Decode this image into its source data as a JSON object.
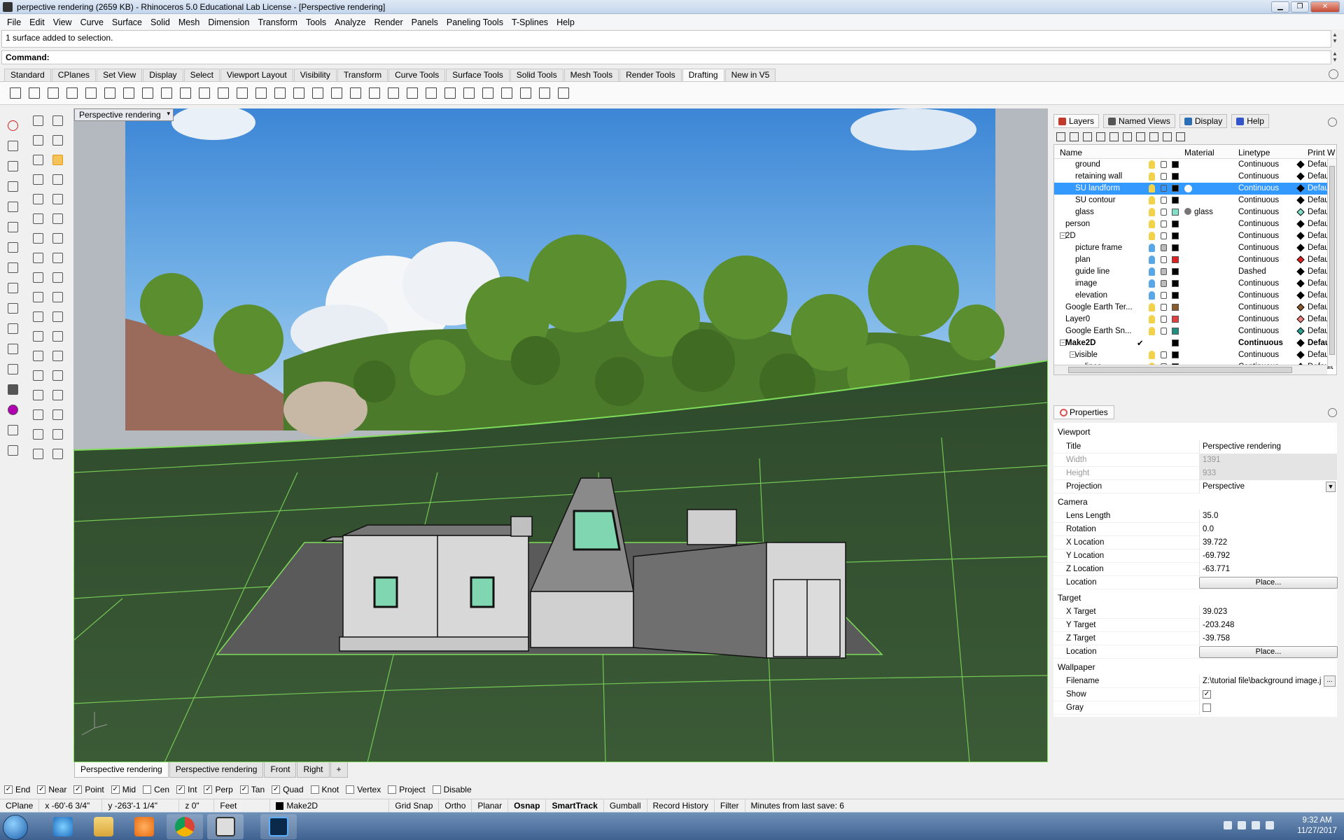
{
  "window": {
    "title": "perpective rendering (2659 KB) - Rhinoceros 5.0 Educational Lab License - [Perspective rendering]"
  },
  "menu": [
    "File",
    "Edit",
    "View",
    "Curve",
    "Surface",
    "Solid",
    "Mesh",
    "Dimension",
    "Transform",
    "Tools",
    "Analyze",
    "Render",
    "Panels",
    "Paneling Tools",
    "T-Splines",
    "Help"
  ],
  "command": {
    "history": "1 surface added to selection.",
    "prompt": "Command:"
  },
  "toolbar_tabs": [
    "Standard",
    "CPlanes",
    "Set View",
    "Display",
    "Select",
    "Viewport Layout",
    "Visibility",
    "Transform",
    "Curve Tools",
    "Surface Tools",
    "Solid Tools",
    "Mesh Tools",
    "Render Tools",
    "Drafting",
    "New in V5"
  ],
  "active_toolbar_tab": "Drafting",
  "viewport": {
    "label": "Perspective rendering",
    "bottom_tabs": [
      "Perspective rendering",
      "Perspective rendering",
      "Front",
      "Right"
    ],
    "add_tab": "+"
  },
  "panels": {
    "tabs": [
      "Layers",
      "Named Views",
      "Display",
      "Help"
    ],
    "layers_columns": {
      "name": "Name",
      "material": "Material",
      "linetype": "Linetype",
      "print": "Print W"
    },
    "layers": [
      {
        "name": "ground",
        "indent": 2,
        "color": "#000000",
        "linetype": "Continuous",
        "print": "Default",
        "bulb": "on",
        "lock": "open"
      },
      {
        "name": "retaining wall",
        "indent": 2,
        "color": "#000000",
        "linetype": "Continuous",
        "print": "Default",
        "bulb": "on",
        "lock": "open"
      },
      {
        "name": "SU landform",
        "indent": 2,
        "color": "#000000",
        "linetype": "Continuous",
        "print": "Default",
        "bulb": "on",
        "lock": "open",
        "selected": true
      },
      {
        "name": "SU contour",
        "indent": 2,
        "color": "#000000",
        "linetype": "Continuous",
        "print": "Default",
        "bulb": "on",
        "lock": "open"
      },
      {
        "name": "glass",
        "indent": 2,
        "color": "#7fe0c8",
        "linetype": "Continuous",
        "print": "Default",
        "bulb": "on",
        "lock": "open",
        "material": "glass",
        "print_color": "#7fe0c8"
      },
      {
        "name": "person",
        "indent": 1,
        "color": "#000000",
        "linetype": "Continuous",
        "print": "Default",
        "bulb": "on",
        "lock": "open"
      },
      {
        "name": "2D",
        "indent": 1,
        "color": "#000000",
        "linetype": "Continuous",
        "print": "Default",
        "bulb": "on",
        "lock": "open",
        "expand": "−"
      },
      {
        "name": "picture frame",
        "indent": 2,
        "color": "#000000",
        "linetype": "Continuous",
        "print": "Default",
        "bulb": "off",
        "lock": "closed"
      },
      {
        "name": "plan",
        "indent": 2,
        "color": "#e02020",
        "linetype": "Continuous",
        "print": "Default",
        "bulb": "off",
        "lock": "open",
        "print_color": "#e02020"
      },
      {
        "name": "guide line",
        "indent": 2,
        "color": "#000000",
        "linetype": "Dashed",
        "print": "Default",
        "bulb": "off",
        "lock": "closed"
      },
      {
        "name": "image",
        "indent": 2,
        "color": "#000000",
        "linetype": "Continuous",
        "print": "Default",
        "bulb": "off",
        "lock": "closed"
      },
      {
        "name": "elevation",
        "indent": 2,
        "color": "#000000",
        "linetype": "Continuous",
        "print": "Default",
        "bulb": "off",
        "lock": "open"
      },
      {
        "name": "Google Earth Ter...",
        "indent": 1,
        "color": "#8b5a2b",
        "linetype": "Continuous",
        "print": "Default",
        "bulb": "on",
        "lock": "open",
        "print_color": "#8b5a2b"
      },
      {
        "name": "Layer0",
        "indent": 1,
        "color": "#e04040",
        "linetype": "Continuous",
        "print": "Default",
        "bulb": "on",
        "lock": "open",
        "print_color": "#f08080"
      },
      {
        "name": "Google Earth Sn...",
        "indent": 1,
        "color": "#1f8f7f",
        "linetype": "Continuous",
        "print": "Default",
        "bulb": "on",
        "lock": "open",
        "print_color": "#2aa090"
      },
      {
        "name": "Make2D",
        "indent": 1,
        "color": "#000000",
        "linetype": "Continuous",
        "print": "Defau",
        "bold": true,
        "check": "✔",
        "expand": "−"
      },
      {
        "name": "visible",
        "indent": 2,
        "color": "#000000",
        "linetype": "Continuous",
        "print": "Default",
        "bulb": "on",
        "lock": "open",
        "expand": "−"
      },
      {
        "name": "lines",
        "indent": 3,
        "color": "#000000",
        "linetype": "Continuous",
        "print": "Default",
        "bulb": "on",
        "lock": "open"
      }
    ],
    "properties_title": "Properties",
    "viewport_group": "Viewport",
    "camera_group": "Camera",
    "target_group": "Target",
    "wallpaper_group": "Wallpaper",
    "props": {
      "title_label": "Title",
      "title": "Perspective rendering",
      "width_label": "Width",
      "width": "1391",
      "height_label": "Height",
      "height": "933",
      "projection_label": "Projection",
      "projection": "Perspective",
      "lens_label": "Lens Length",
      "lens": "35.0",
      "rotation_label": "Rotation",
      "rotation": "0.0",
      "xloc_label": "X Location",
      "xloc": "39.722",
      "yloc_label": "Y Location",
      "yloc": "-69.792",
      "zloc_label": "Z Location",
      "zloc": "-63.771",
      "location_label": "Location",
      "place": "Place...",
      "xt_label": "X Target",
      "xt": "39.023",
      "yt_label": "Y Target",
      "yt": "-203.248",
      "zt_label": "Z Target",
      "zt": "-39.758",
      "filename_label": "Filename",
      "filename": "Z:\\tutorial file\\background image.jpg",
      "show_label": "Show",
      "gray_label": "Gray",
      "more": "..."
    }
  },
  "osnap": [
    {
      "label": "End",
      "checked": true
    },
    {
      "label": "Near",
      "checked": true
    },
    {
      "label": "Point",
      "checked": true
    },
    {
      "label": "Mid",
      "checked": true
    },
    {
      "label": "Cen",
      "checked": false
    },
    {
      "label": "Int",
      "checked": true
    },
    {
      "label": "Perp",
      "checked": true
    },
    {
      "label": "Tan",
      "checked": true
    },
    {
      "label": "Quad",
      "checked": true
    },
    {
      "label": "Knot",
      "checked": false
    },
    {
      "label": "Vertex",
      "checked": false
    },
    {
      "label": "Project",
      "checked": false
    },
    {
      "label": "Disable",
      "checked": false
    }
  ],
  "status": {
    "cplane": "CPlane",
    "x": "x -60'-6 3/4\"",
    "y": "y -263'-1 1/4\"",
    "z": "z 0\"",
    "units": "Feet",
    "layer": "Make2D",
    "toggles": [
      "Grid Snap",
      "Ortho",
      "Planar",
      "Osnap",
      "SmartTrack",
      "Gumball",
      "Record History",
      "Filter"
    ],
    "bold_toggles": [
      "Osnap",
      "SmartTrack"
    ],
    "save": "Minutes from last save: 6"
  },
  "taskbar": {
    "time": "9:32 AM",
    "date": "11/27/2017"
  }
}
